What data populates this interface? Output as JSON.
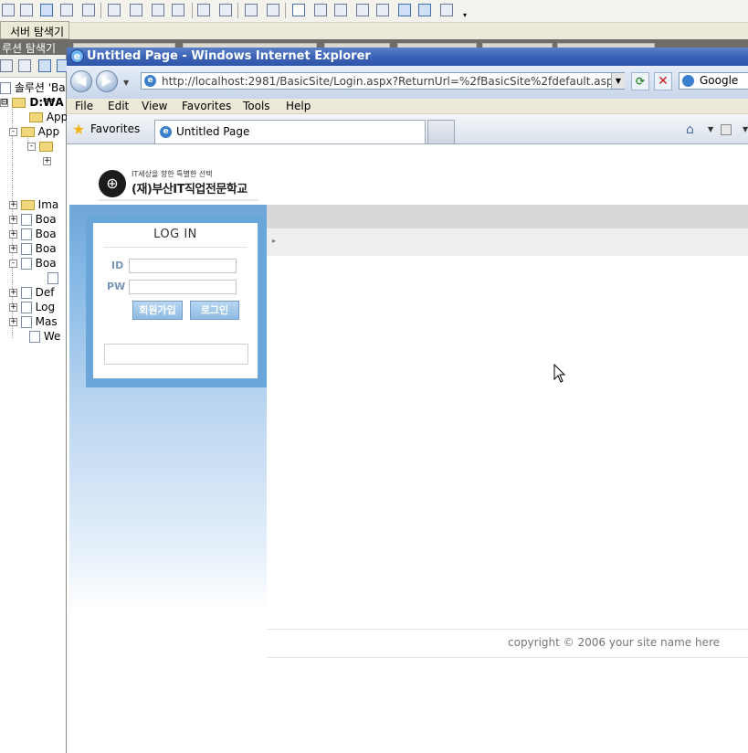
{
  "vs": {
    "server_tab": "서버 탐색기",
    "solution_strip_title": "루션 탐색기",
    "toolbar_more": "▾"
  },
  "solution_tree": {
    "items": [
      {
        "label": "솔루션 'Ba",
        "pm": ""
      },
      {
        "label": "D:₩A",
        "pm": "⊟"
      },
      {
        "label": "App",
        "pm": ""
      },
      {
        "label": "App",
        "pm": "-"
      },
      {
        "label": "",
        "pm": "-"
      },
      {
        "label": "",
        "pm": "+"
      },
      {
        "label": "Ima",
        "pm": "+"
      },
      {
        "label": "Boa",
        "pm": "+"
      },
      {
        "label": "Boa",
        "pm": "+"
      },
      {
        "label": "Boa",
        "pm": "+"
      },
      {
        "label": "Boa",
        "pm": "-"
      },
      {
        "label": "",
        "pm": ""
      },
      {
        "label": "Def",
        "pm": "+"
      },
      {
        "label": "Log",
        "pm": "+"
      },
      {
        "label": "Mas",
        "pm": "+"
      },
      {
        "label": "We",
        "pm": ""
      }
    ]
  },
  "ie": {
    "window_title": "Untitled Page - Windows Internet Explorer",
    "address": "http://localhost:2981/BasicSite/Login.aspx?ReturnUrl=%2fBasicSite%2fdefault.aspx",
    "search_provider": "Google",
    "menu": [
      "File",
      "Edit",
      "View",
      "Favorites",
      "Tools",
      "Help"
    ],
    "favorites_label": "Favorites",
    "tab_title": "Untitled Page"
  },
  "page": {
    "logo_tagline": "IT세상을 향한 특별한 선택",
    "logo_name": "(재)부산IT직업전문학교",
    "login": {
      "title": "LOG IN",
      "id_label": "ID",
      "pw_label": "PW",
      "id_value": "",
      "pw_value": "",
      "join_button": "회원가입",
      "login_button": "로그인"
    },
    "copyright": "copyright © 2006 your site name here"
  },
  "colors": {
    "titlebar": "#3a61b5",
    "login_frame": "#6aa6d8",
    "button_fill": "#8dbbe3"
  }
}
